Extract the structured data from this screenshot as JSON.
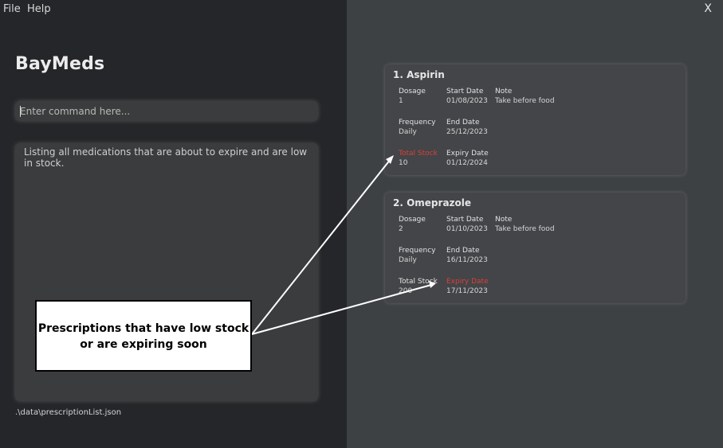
{
  "menu": {
    "file_label": "File",
    "help_label": "Help",
    "close_label": "X"
  },
  "app": {
    "title": "BayMeds"
  },
  "command": {
    "placeholder": "Enter command here..."
  },
  "result": {
    "text": "Listing all medications that are about to expire and are low in stock."
  },
  "status": {
    "path": ".\\data\\prescriptionList.json"
  },
  "prescriptions": [
    {
      "title": "1.  Aspirin",
      "dosage_label": "Dosage",
      "dosage": "1",
      "start_label": "Start Date",
      "start_date": "01/08/2023",
      "note_label": "Note",
      "note": "Take before food",
      "frequency_label": "Frequency",
      "frequency": "Daily",
      "end_label": "End Date",
      "end_date": "25/12/2023",
      "stock_label": "Total Stock",
      "stock": "10",
      "expiry_label": "Expiry Date",
      "expiry_date": "01/12/2024",
      "warning": "low-stock"
    },
    {
      "title": "2.  Omeprazole",
      "dosage_label": "Dosage",
      "dosage": "2",
      "start_label": "Start Date",
      "start_date": "01/10/2023",
      "note_label": "Note",
      "note": "Take before food",
      "frequency_label": "Frequency",
      "frequency": "Daily",
      "end_label": "End Date",
      "end_date": "16/11/2023",
      "stock_label": "Total Stock",
      "stock": "200",
      "expiry_label": "Expiry Date",
      "expiry_date": "17/11/2023",
      "warning": "expiring-soon"
    }
  ],
  "annotation": {
    "line1": "Prescriptions that have low stock",
    "line2": "or are expiring soon"
  },
  "colors": {
    "left_bg": "#252629",
    "right_bg": "#3e4144",
    "card_bg": "#434548",
    "warning": "#d9403a"
  }
}
